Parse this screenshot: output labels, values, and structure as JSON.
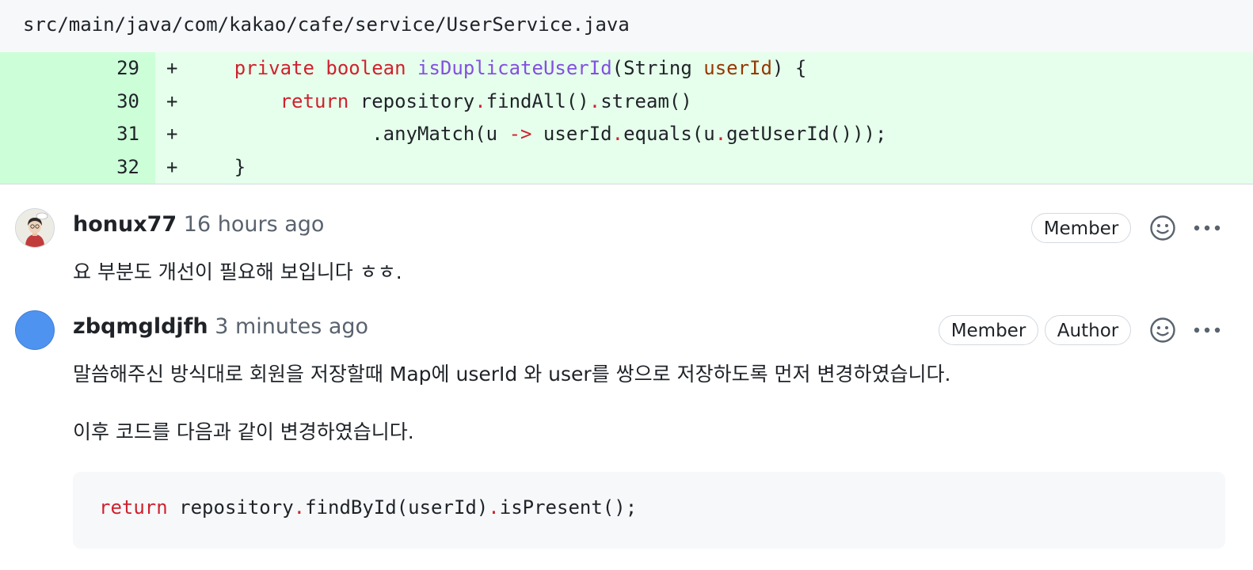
{
  "file": {
    "path": "src/main/java/com/kakao/cafe/service/UserService.java"
  },
  "diff": {
    "lines": [
      {
        "num": "29",
        "sign": "+",
        "indent": "    ",
        "tokens": [
          {
            "t": "private",
            "c": "kw"
          },
          {
            "t": " "
          },
          {
            "t": "boolean",
            "c": "kw"
          },
          {
            "t": " "
          },
          {
            "t": "isDuplicateUserId",
            "c": "fn"
          },
          {
            "t": "(String "
          },
          {
            "t": "userId",
            "c": "var"
          },
          {
            "t": ") {"
          }
        ]
      },
      {
        "num": "30",
        "sign": "+",
        "indent": "        ",
        "tokens": [
          {
            "t": "return",
            "c": "kw"
          },
          {
            "t": " repository"
          },
          {
            "t": ".",
            "c": "op"
          },
          {
            "t": "findAll()"
          },
          {
            "t": ".",
            "c": "op"
          },
          {
            "t": "stream()"
          }
        ]
      },
      {
        "num": "31",
        "sign": "+",
        "indent": "                ",
        "tokens": [
          {
            "t": ".anyMatch(u "
          },
          {
            "t": "->",
            "c": "op"
          },
          {
            "t": " userId"
          },
          {
            "t": ".",
            "c": "op"
          },
          {
            "t": "equals(u"
          },
          {
            "t": ".",
            "c": "op"
          },
          {
            "t": "getUserId()));"
          }
        ]
      },
      {
        "num": "32",
        "sign": "+",
        "indent": "    ",
        "tokens": [
          {
            "t": "}"
          }
        ]
      }
    ]
  },
  "comments": [
    {
      "author": "honux77",
      "time": "16 hours ago",
      "badges": [
        "Member"
      ],
      "body": [
        "요 부분도 개선이 필요해 보입니다 ㅎㅎ."
      ]
    },
    {
      "author": "zbqmgldjfh",
      "time": "3 minutes ago",
      "badges": [
        "Member",
        "Author"
      ],
      "body": [
        "말씀해주신 방식대로 회원을 저장할때 Map에 userId 와 user를 쌍으로 저장하도록 먼저 변경하였습니다.",
        "이후 코드를 다음과 같이 변경하였습니다."
      ],
      "code": [
        {
          "t": "return",
          "c": "kw"
        },
        {
          "t": " repository"
        },
        {
          "t": ".",
          "c": "op"
        },
        {
          "t": "findById(userId)"
        },
        {
          "t": ".",
          "c": "op"
        },
        {
          "t": "isPresent();"
        }
      ]
    }
  ],
  "icons": {
    "add_reaction": "smiley-icon",
    "more_options": "kebab-horizontal-icon"
  },
  "colors": {
    "addition_bg": "#e6ffec",
    "addition_gutter": "#ccffd8",
    "keyword": "#cf222e",
    "function": "#8250df",
    "variable": "#953800",
    "muted_text": "#59636e"
  }
}
